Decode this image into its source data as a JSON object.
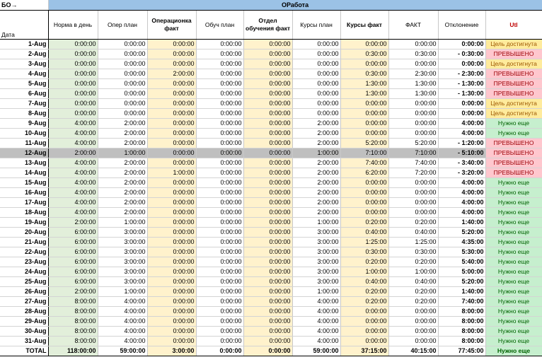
{
  "header": {
    "corner_label": "БО→",
    "section_label": "ОРабота",
    "date_label": "Дата",
    "columns": [
      "Норма в день",
      "Опер план",
      "Операционка факт",
      "Обуч план",
      "Отдел обучения факт",
      "Курсы план",
      "Курсы факт",
      "ФАКТ",
      "Отклонение",
      "Utl"
    ]
  },
  "rows": [
    {
      "date": "1-Aug",
      "norma": "0:00:00",
      "oper_plan": "0:00:00",
      "oper_fact": "0:00:00",
      "obuch_plan": "0:00:00",
      "otdel_fact": "0:00:00",
      "kursy_plan": "0:00:00",
      "kursy_fact": "0:00:00",
      "fakt": "0:00:00",
      "otkl": "0:00:00",
      "status": "Цель достигнута"
    },
    {
      "date": "2-Aug",
      "norma": "0:00:00",
      "oper_plan": "0:00:00",
      "oper_fact": "0:00:00",
      "obuch_plan": "0:00:00",
      "otdel_fact": "0:00:00",
      "kursy_plan": "0:00:00",
      "kursy_fact": "0:30:00",
      "fakt": "0:30:00",
      "otkl": "- 0:30:00",
      "status": "ПРЕВЫШЕНО"
    },
    {
      "date": "3-Aug",
      "norma": "0:00:00",
      "oper_plan": "0:00:00",
      "oper_fact": "0:00:00",
      "obuch_plan": "0:00:00",
      "otdel_fact": "0:00:00",
      "kursy_plan": "0:00:00",
      "kursy_fact": "0:00:00",
      "fakt": "0:00:00",
      "otkl": "0:00:00",
      "status": "Цель достигнута"
    },
    {
      "date": "4-Aug",
      "norma": "0:00:00",
      "oper_plan": "0:00:00",
      "oper_fact": "2:00:00",
      "obuch_plan": "0:00:00",
      "otdel_fact": "0:00:00",
      "kursy_plan": "0:00:00",
      "kursy_fact": "0:30:00",
      "fakt": "2:30:00",
      "otkl": "- 2:30:00",
      "status": "ПРЕВЫШЕНО"
    },
    {
      "date": "5-Aug",
      "norma": "0:00:00",
      "oper_plan": "0:00:00",
      "oper_fact": "0:00:00",
      "obuch_plan": "0:00:00",
      "otdel_fact": "0:00:00",
      "kursy_plan": "0:00:00",
      "kursy_fact": "1:30:00",
      "fakt": "1:30:00",
      "otkl": "- 1:30:00",
      "status": "ПРЕВЫШЕНО"
    },
    {
      "date": "6-Aug",
      "norma": "0:00:00",
      "oper_plan": "0:00:00",
      "oper_fact": "0:00:00",
      "obuch_plan": "0:00:00",
      "otdel_fact": "0:00:00",
      "kursy_plan": "0:00:00",
      "kursy_fact": "1:30:00",
      "fakt": "1:30:00",
      "otkl": "- 1:30:00",
      "status": "ПРЕВЫШЕНО"
    },
    {
      "date": "7-Aug",
      "norma": "0:00:00",
      "oper_plan": "0:00:00",
      "oper_fact": "0:00:00",
      "obuch_plan": "0:00:00",
      "otdel_fact": "0:00:00",
      "kursy_plan": "0:00:00",
      "kursy_fact": "0:00:00",
      "fakt": "0:00:00",
      "otkl": "0:00:00",
      "status": "Цель достигнута"
    },
    {
      "date": "8-Aug",
      "norma": "0:00:00",
      "oper_plan": "0:00:00",
      "oper_fact": "0:00:00",
      "obuch_plan": "0:00:00",
      "otdel_fact": "0:00:00",
      "kursy_plan": "0:00:00",
      "kursy_fact": "0:00:00",
      "fakt": "0:00:00",
      "otkl": "0:00:00",
      "status": "Цель достигнута"
    },
    {
      "date": "9-Aug",
      "norma": "4:00:00",
      "oper_plan": "2:00:00",
      "oper_fact": "0:00:00",
      "obuch_plan": "0:00:00",
      "otdel_fact": "0:00:00",
      "kursy_plan": "2:00:00",
      "kursy_fact": "0:00:00",
      "fakt": "0:00:00",
      "otkl": "4:00:00",
      "status": "Нужно еще"
    },
    {
      "date": "10-Aug",
      "norma": "4:00:00",
      "oper_plan": "2:00:00",
      "oper_fact": "0:00:00",
      "obuch_plan": "0:00:00",
      "otdel_fact": "0:00:00",
      "kursy_plan": "2:00:00",
      "kursy_fact": "0:00:00",
      "fakt": "0:00:00",
      "otkl": "4:00:00",
      "status": "Нужно еще"
    },
    {
      "date": "11-Aug",
      "norma": "4:00:00",
      "oper_plan": "2:00:00",
      "oper_fact": "0:00:00",
      "obuch_plan": "0:00:00",
      "otdel_fact": "0:00:00",
      "kursy_plan": "2:00:00",
      "kursy_fact": "5:20:00",
      "fakt": "5:20:00",
      "otkl": "- 1:20:00",
      "status": "ПРЕВЫШЕНО"
    },
    {
      "date": "12-Aug",
      "norma": "2:00:00",
      "oper_plan": "1:00:00",
      "oper_fact": "0:00:00",
      "obuch_plan": "0:00:00",
      "otdel_fact": "0:00:00",
      "kursy_plan": "1:00:00",
      "kursy_fact": "7:10:00",
      "fakt": "7:10:00",
      "otkl": "- 5:10:00",
      "status": "ПРЕВЫШЕНО"
    },
    {
      "date": "13-Aug",
      "norma": "4:00:00",
      "oper_plan": "2:00:00",
      "oper_fact": "0:00:00",
      "obuch_plan": "0:00:00",
      "otdel_fact": "0:00:00",
      "kursy_plan": "2:00:00",
      "kursy_fact": "7:40:00",
      "fakt": "7:40:00",
      "otkl": "- 3:40:00",
      "status": "ПРЕВЫШЕНО"
    },
    {
      "date": "14-Aug",
      "norma": "4:00:00",
      "oper_plan": "2:00:00",
      "oper_fact": "1:00:00",
      "obuch_plan": "0:00:00",
      "otdel_fact": "0:00:00",
      "kursy_plan": "2:00:00",
      "kursy_fact": "6:20:00",
      "fakt": "7:20:00",
      "otkl": "- 3:20:00",
      "status": "ПРЕВЫШЕНО"
    },
    {
      "date": "15-Aug",
      "norma": "4:00:00",
      "oper_plan": "2:00:00",
      "oper_fact": "0:00:00",
      "obuch_plan": "0:00:00",
      "otdel_fact": "0:00:00",
      "kursy_plan": "2:00:00",
      "kursy_fact": "0:00:00",
      "fakt": "0:00:00",
      "otkl": "4:00:00",
      "status": "Нужно еще"
    },
    {
      "date": "16-Aug",
      "norma": "4:00:00",
      "oper_plan": "2:00:00",
      "oper_fact": "0:00:00",
      "obuch_plan": "0:00:00",
      "otdel_fact": "0:00:00",
      "kursy_plan": "2:00:00",
      "kursy_fact": "0:00:00",
      "fakt": "0:00:00",
      "otkl": "4:00:00",
      "status": "Нужно еще"
    },
    {
      "date": "17-Aug",
      "norma": "4:00:00",
      "oper_plan": "2:00:00",
      "oper_fact": "0:00:00",
      "obuch_plan": "0:00:00",
      "otdel_fact": "0:00:00",
      "kursy_plan": "2:00:00",
      "kursy_fact": "0:00:00",
      "fakt": "0:00:00",
      "otkl": "4:00:00",
      "status": "Нужно еще"
    },
    {
      "date": "18-Aug",
      "norma": "4:00:00",
      "oper_plan": "2:00:00",
      "oper_fact": "0:00:00",
      "obuch_plan": "0:00:00",
      "otdel_fact": "0:00:00",
      "kursy_plan": "2:00:00",
      "kursy_fact": "0:00:00",
      "fakt": "0:00:00",
      "otkl": "4:00:00",
      "status": "Нужно еще"
    },
    {
      "date": "19-Aug",
      "norma": "2:00:00",
      "oper_plan": "1:00:00",
      "oper_fact": "0:00:00",
      "obuch_plan": "0:00:00",
      "otdel_fact": "0:00:00",
      "kursy_plan": "1:00:00",
      "kursy_fact": "0:20:00",
      "fakt": "0:20:00",
      "otkl": "1:40:00",
      "status": "Нужно еще"
    },
    {
      "date": "20-Aug",
      "norma": "6:00:00",
      "oper_plan": "3:00:00",
      "oper_fact": "0:00:00",
      "obuch_plan": "0:00:00",
      "otdel_fact": "0:00:00",
      "kursy_plan": "3:00:00",
      "kursy_fact": "0:40:00",
      "fakt": "0:40:00",
      "otkl": "5:20:00",
      "status": "Нужно еще"
    },
    {
      "date": "21-Aug",
      "norma": "6:00:00",
      "oper_plan": "3:00:00",
      "oper_fact": "0:00:00",
      "obuch_plan": "0:00:00",
      "otdel_fact": "0:00:00",
      "kursy_plan": "3:00:00",
      "kursy_fact": "1:25:00",
      "fakt": "1:25:00",
      "otkl": "4:35:00",
      "status": "Нужно еще"
    },
    {
      "date": "22-Aug",
      "norma": "6:00:00",
      "oper_plan": "3:00:00",
      "oper_fact": "0:00:00",
      "obuch_plan": "0:00:00",
      "otdel_fact": "0:00:00",
      "kursy_plan": "3:00:00",
      "kursy_fact": "0:30:00",
      "fakt": "0:30:00",
      "otkl": "5:30:00",
      "status": "Нужно еще"
    },
    {
      "date": "23-Aug",
      "norma": "6:00:00",
      "oper_plan": "3:00:00",
      "oper_fact": "0:00:00",
      "obuch_plan": "0:00:00",
      "otdel_fact": "0:00:00",
      "kursy_plan": "3:00:00",
      "kursy_fact": "0:20:00",
      "fakt": "0:20:00",
      "otkl": "5:40:00",
      "status": "Нужно еще"
    },
    {
      "date": "24-Aug",
      "norma": "6:00:00",
      "oper_plan": "3:00:00",
      "oper_fact": "0:00:00",
      "obuch_plan": "0:00:00",
      "otdel_fact": "0:00:00",
      "kursy_plan": "3:00:00",
      "kursy_fact": "1:00:00",
      "fakt": "1:00:00",
      "otkl": "5:00:00",
      "status": "Нужно еще"
    },
    {
      "date": "25-Aug",
      "norma": "6:00:00",
      "oper_plan": "3:00:00",
      "oper_fact": "0:00:00",
      "obuch_plan": "0:00:00",
      "otdel_fact": "0:00:00",
      "kursy_plan": "3:00:00",
      "kursy_fact": "0:40:00",
      "fakt": "0:40:00",
      "otkl": "5:20:00",
      "status": "Нужно еще"
    },
    {
      "date": "26-Aug",
      "norma": "2:00:00",
      "oper_plan": "1:00:00",
      "oper_fact": "0:00:00",
      "obuch_plan": "0:00:00",
      "otdel_fact": "0:00:00",
      "kursy_plan": "1:00:00",
      "kursy_fact": "0:20:00",
      "fakt": "0:20:00",
      "otkl": "1:40:00",
      "status": "Нужно еще"
    },
    {
      "date": "27-Aug",
      "norma": "8:00:00",
      "oper_plan": "4:00:00",
      "oper_fact": "0:00:00",
      "obuch_plan": "0:00:00",
      "otdel_fact": "0:00:00",
      "kursy_plan": "4:00:00",
      "kursy_fact": "0:20:00",
      "fakt": "0:20:00",
      "otkl": "7:40:00",
      "status": "Нужно еще"
    },
    {
      "date": "28-Aug",
      "norma": "8:00:00",
      "oper_plan": "4:00:00",
      "oper_fact": "0:00:00",
      "obuch_plan": "0:00:00",
      "otdel_fact": "0:00:00",
      "kursy_plan": "4:00:00",
      "kursy_fact": "0:00:00",
      "fakt": "0:00:00",
      "otkl": "8:00:00",
      "status": "Нужно еще"
    },
    {
      "date": "29-Aug",
      "norma": "8:00:00",
      "oper_plan": "4:00:00",
      "oper_fact": "0:00:00",
      "obuch_plan": "0:00:00",
      "otdel_fact": "0:00:00",
      "kursy_plan": "4:00:00",
      "kursy_fact": "0:00:00",
      "fakt": "0:00:00",
      "otkl": "8:00:00",
      "status": "Нужно еще"
    },
    {
      "date": "30-Aug",
      "norma": "8:00:00",
      "oper_plan": "4:00:00",
      "oper_fact": "0:00:00",
      "obuch_plan": "0:00:00",
      "otdel_fact": "0:00:00",
      "kursy_plan": "4:00:00",
      "kursy_fact": "0:00:00",
      "fakt": "0:00:00",
      "otkl": "8:00:00",
      "status": "Нужно еще"
    },
    {
      "date": "31-Aug",
      "norma": "8:00:00",
      "oper_plan": "4:00:00",
      "oper_fact": "0:00:00",
      "obuch_plan": "0:00:00",
      "otdel_fact": "0:00:00",
      "kursy_plan": "4:00:00",
      "kursy_fact": "0:00:00",
      "fakt": "0:00:00",
      "otkl": "8:00:00",
      "status": "Нужно еще"
    }
  ],
  "total": {
    "date": "TOTAL",
    "norma": "118:00:00",
    "oper_plan": "59:00:00",
    "oper_fact": "3:00:00",
    "obuch_plan": "0:00:00",
    "otdel_fact": "0:00:00",
    "kursy_plan": "59:00:00",
    "kursy_fact": "37:15:00",
    "fakt": "40:15:00",
    "otkl": "77:45:00",
    "status": "Нужно еще"
  },
  "colors": {
    "section_blue": "#9bc2e6",
    "fact_yellow": "#fff2cc",
    "norma_green": "#e2efda",
    "status_red_bg": "#ffc7ce",
    "status_green_bg": "#c6efce",
    "status_yellow_bg": "#ffeb9c",
    "selected_row": "#bfbfbf"
  }
}
